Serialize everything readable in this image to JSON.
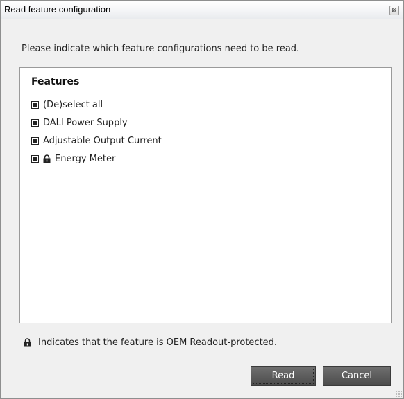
{
  "window": {
    "title": "Read feature configuration",
    "close_glyph": "⊠"
  },
  "instruction": "Please indicate which feature configurations need to be read.",
  "features": {
    "heading": "Features",
    "items": [
      {
        "label": "(De)select all",
        "checked": true,
        "locked": false
      },
      {
        "label": "DALI Power Supply",
        "checked": true,
        "locked": false
      },
      {
        "label": "Adjustable Output Current",
        "checked": true,
        "locked": false
      },
      {
        "label": "Energy Meter",
        "checked": true,
        "locked": true
      }
    ]
  },
  "footer": {
    "note": "Indicates that the feature is OEM Readout-protected."
  },
  "buttons": {
    "read": "Read",
    "cancel": "Cancel"
  },
  "colors": {
    "button_bg": "#5a5a5a",
    "dialog_bg": "#f0f0f0",
    "panel_bg": "#ffffff"
  },
  "icons": {
    "lock": "lock-icon",
    "close": "close-icon",
    "resize": "resize-grip-icon"
  }
}
